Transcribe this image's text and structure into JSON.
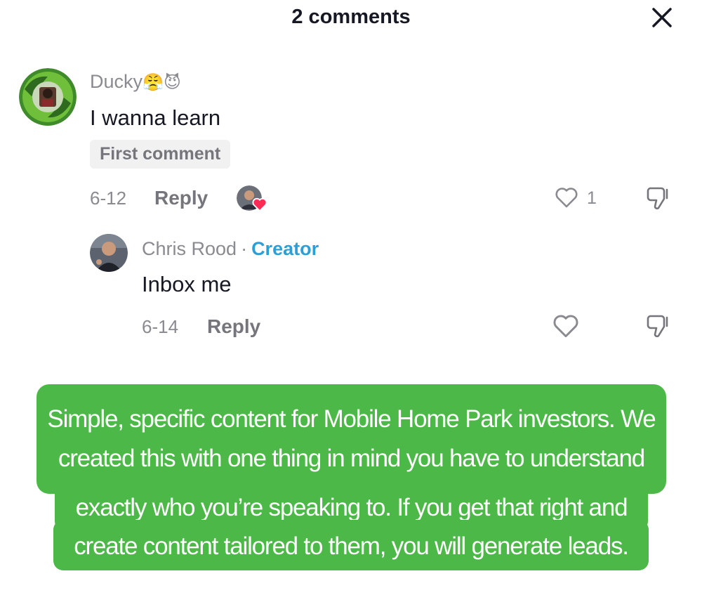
{
  "header": {
    "title": "2 comments"
  },
  "comments": [
    {
      "username": "Ducky",
      "emojis": "😤😈",
      "text": "I wanna learn",
      "badge": "First comment",
      "date": "6-12",
      "reply_label": "Reply",
      "like_count": "1"
    }
  ],
  "replies": [
    {
      "username": "Chris Rood",
      "separator": "·",
      "tag": "Creator",
      "text": "Inbox me",
      "date": "6-14",
      "reply_label": "Reply"
    }
  ],
  "caption": {
    "lines": [
      "Simple, specific content for Mobile Home Park investors. We",
      "created this with one thing in mind you have to understand",
      "exactly who you’re speaking to. If you get that right and",
      "create content tailored to them, you will generate leads."
    ]
  },
  "colors": {
    "caption_bg": "#4cb847",
    "creator": "#2b9fd6",
    "heart_red": "#fe2c55"
  }
}
